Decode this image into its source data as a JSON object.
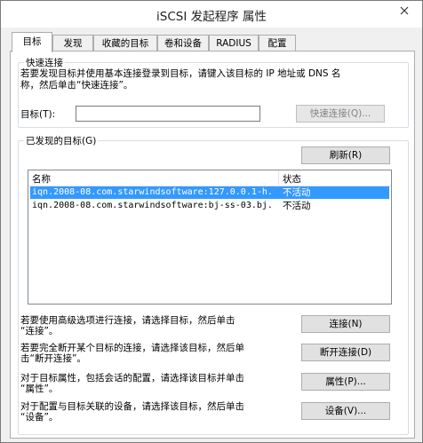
{
  "window": {
    "title": "iSCSI 发起程序 属性"
  },
  "tabs": [
    {
      "label": "目标",
      "active": true
    },
    {
      "label": "发现",
      "active": false
    },
    {
      "label": "收藏的目标",
      "active": false
    },
    {
      "label": "卷和设备",
      "active": false
    },
    {
      "label": "RADIUS",
      "active": false
    },
    {
      "label": "配置",
      "active": false
    }
  ],
  "quick_connect": {
    "legend": "快速连接",
    "description_line1": "若要发现目标并使用基本连接登录到目标，请键入该目标的 IP 地址或 DNS 名",
    "description_line2": "称，然后单击“快速连接”。",
    "target_label": "目标(T):",
    "target_value": "",
    "button": "快速连接(Q)..."
  },
  "discovered": {
    "legend": "已发现的目标(G)",
    "refresh_button": "刷新(R)",
    "columns": [
      "名称",
      "状态"
    ],
    "rows": [
      {
        "name": "iqn.2008-08.com.starwindsoftware:127.0.0.1-h...",
        "status": "不活动",
        "selected": true
      },
      {
        "name": "iqn.2008-08.com.starwindsoftware:bj-ss-03.bj...",
        "status": "不活动",
        "selected": false
      }
    ]
  },
  "actions": [
    {
      "line1": "若要使用高级选项进行连接，请选择目标，然后单击",
      "line2": "“连接”。",
      "button": "连接(N)"
    },
    {
      "line1": "若要完全断开某个目标的连接，请选择该目标，然后单",
      "line2": "击“断开连接”。",
      "button": "断开连接(D)"
    },
    {
      "line1": "对于目标属性，包括会话的配置，请选择该目标并单击",
      "line2": "“属性”。",
      "button": "属性(P)..."
    },
    {
      "line1": "对于配置与目标关联的设备，请选择该目标，然后单击",
      "line2": "“设备”。",
      "button": "设备(V)..."
    }
  ]
}
